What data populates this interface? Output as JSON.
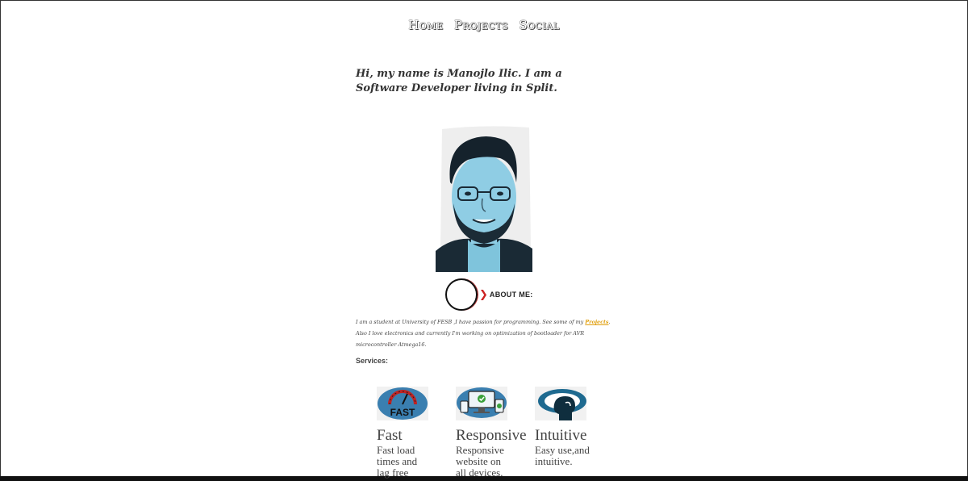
{
  "nav": {
    "items": [
      {
        "label": "Home"
      },
      {
        "label": "Projects"
      },
      {
        "label": "Social"
      }
    ]
  },
  "intro": {
    "text": "Hi, my name is Manojlo Ilic. I am a Software Developer living in Split."
  },
  "about": {
    "label": "ABOUT ME:",
    "text_part1": "I am a student at University of FESB ,I have passion for programming. See some of my ",
    "projects_link": "Projects",
    "text_part2": ". Also I love electronics and currently I'm working on optimization of bootloader for AVR microcontroller Atmega16."
  },
  "services": {
    "label": "Services:",
    "items": [
      {
        "title": "Fast",
        "desc": "Fast load times and lag free",
        "icon": "speedometer-icon",
        "icon_text": "FAST"
      },
      {
        "title": "Responsive",
        "desc": "Responsive website on all devices.",
        "icon": "devices-icon"
      },
      {
        "title": "Intuitive",
        "desc": "Easy use,and intuitive.",
        "icon": "head-eye-icon"
      }
    ]
  },
  "colors": {
    "link": "#e0a010",
    "accent_red": "#c22222",
    "icon_blue": "#3a7fb0"
  }
}
